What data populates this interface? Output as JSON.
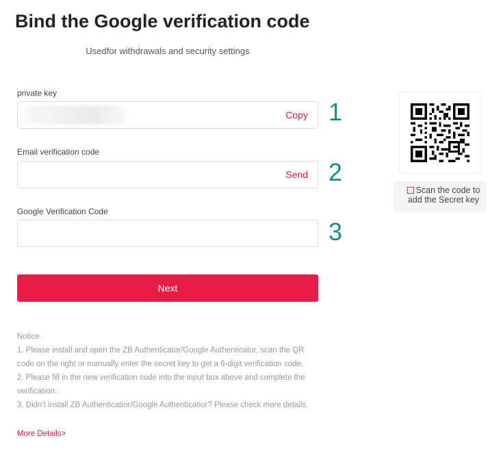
{
  "header": {
    "title": "Bind the Google verification code",
    "subtitle": "Usedfor withdrawals and security settings"
  },
  "fields": {
    "private_key": {
      "label": "private key",
      "value": "",
      "action": "Copy",
      "step": "1"
    },
    "email_code": {
      "label": "Email verification code",
      "value": "",
      "placeholder": "",
      "action": "Send",
      "step": "2"
    },
    "google_code": {
      "label": "Google Verification Code",
      "value": "",
      "placeholder": "",
      "step": "3"
    }
  },
  "next_button": {
    "label": "Next"
  },
  "notice": {
    "heading": "Notice",
    "items": [
      "1. Please install and open the ZB Authenticator/Google Authenticator, scan the QR code on the right or manually enter the secret key to get a 6-digit verification code.",
      "2. Please fill in the new verification code into the input box above and complete the verification.",
      "3. Didn't install ZB Authenticatior/Google Authenticatior? Please check more details."
    ],
    "more_link": "More Details>"
  },
  "qr": {
    "icon": "scan-icon",
    "caption": "Scan the code to add the Secret key"
  },
  "colors": {
    "accent": "#e91c46",
    "step_number": "#1d8a8a"
  }
}
